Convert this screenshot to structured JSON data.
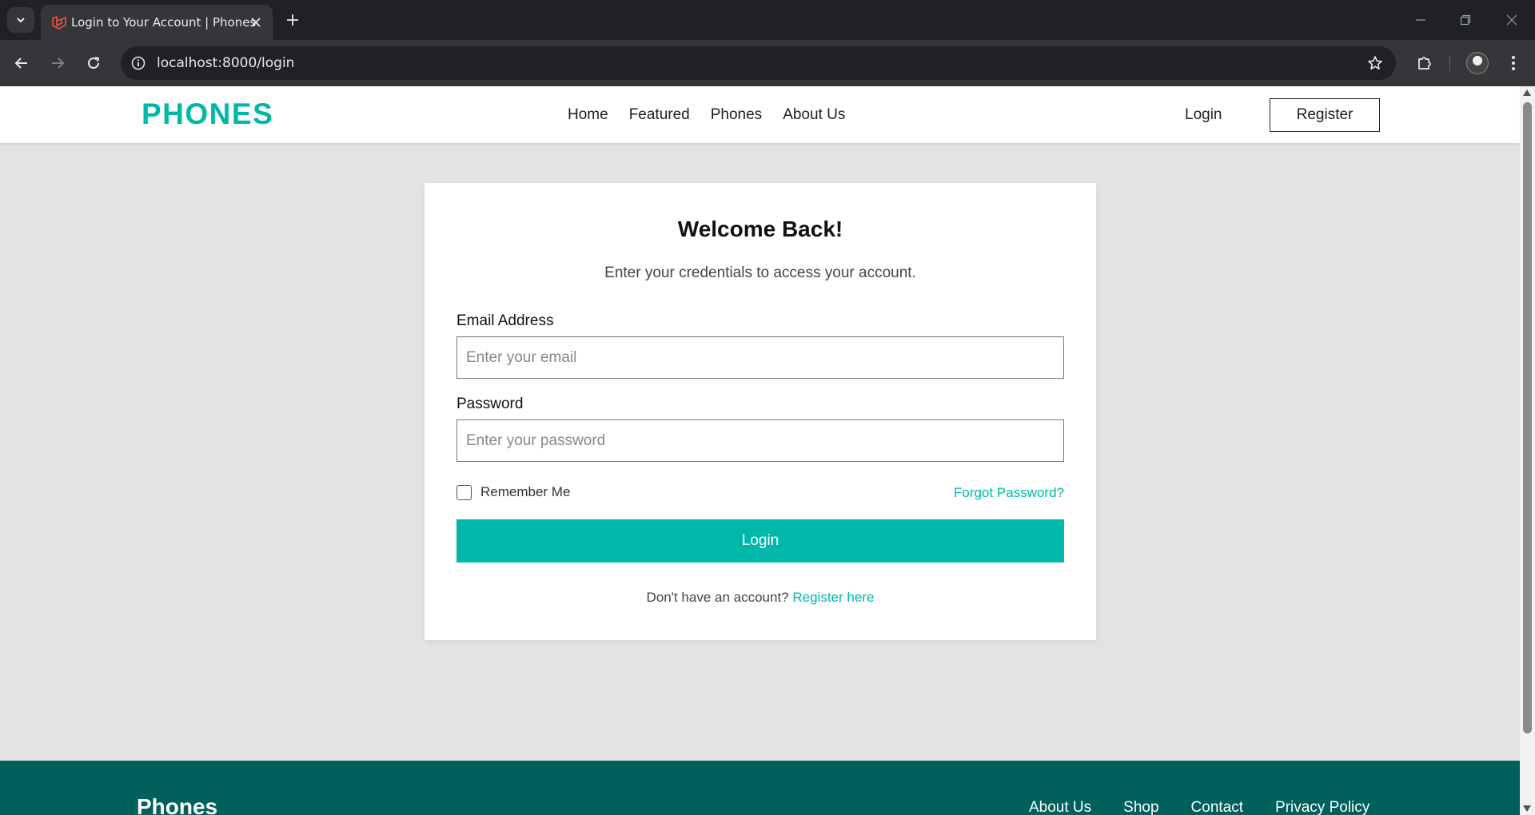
{
  "browser": {
    "tab_title": "Login to Your Account | Phones",
    "url": "localhost:8000/login",
    "icons": {
      "tab_list": "chevron-down-icon",
      "favicon": "laravel-icon",
      "tab_close": "close-icon",
      "new_tab": "plus-icon",
      "minimize": "minimize-icon",
      "restore": "restore-icon",
      "close_window": "close-icon",
      "back": "arrow-left-icon",
      "forward": "arrow-right-icon",
      "reload": "reload-icon",
      "site_info": "info-icon",
      "bookmark": "star-icon",
      "extensions": "puzzle-icon",
      "profile": "avatar",
      "menu": "kebab-menu-icon"
    }
  },
  "header": {
    "logo": "PHONES",
    "nav": [
      "Home",
      "Featured",
      "Phones",
      "About Us"
    ],
    "login": "Login",
    "register": "Register"
  },
  "login_form": {
    "title": "Welcome Back!",
    "subtitle": "Enter your credentials to access your account.",
    "email_label": "Email Address",
    "email_placeholder": "Enter your email",
    "email_value": "",
    "password_label": "Password",
    "password_placeholder": "Enter your password",
    "password_value": "",
    "remember_me": "Remember Me",
    "remember_checked": false,
    "forgot_password": "Forgot Password?",
    "submit": "Login",
    "no_account_text": "Don't have an account?",
    "register_link": "Register here"
  },
  "footer": {
    "brand": "Phones",
    "links": [
      "About Us",
      "Shop",
      "Contact",
      "Privacy Policy"
    ]
  },
  "colors": {
    "accent": "#00b8a9",
    "footer_bg": "#00605b",
    "page_bg": "#e3e3e3",
    "chrome_dark": "#202124",
    "chrome_toolbar": "#35363a"
  }
}
